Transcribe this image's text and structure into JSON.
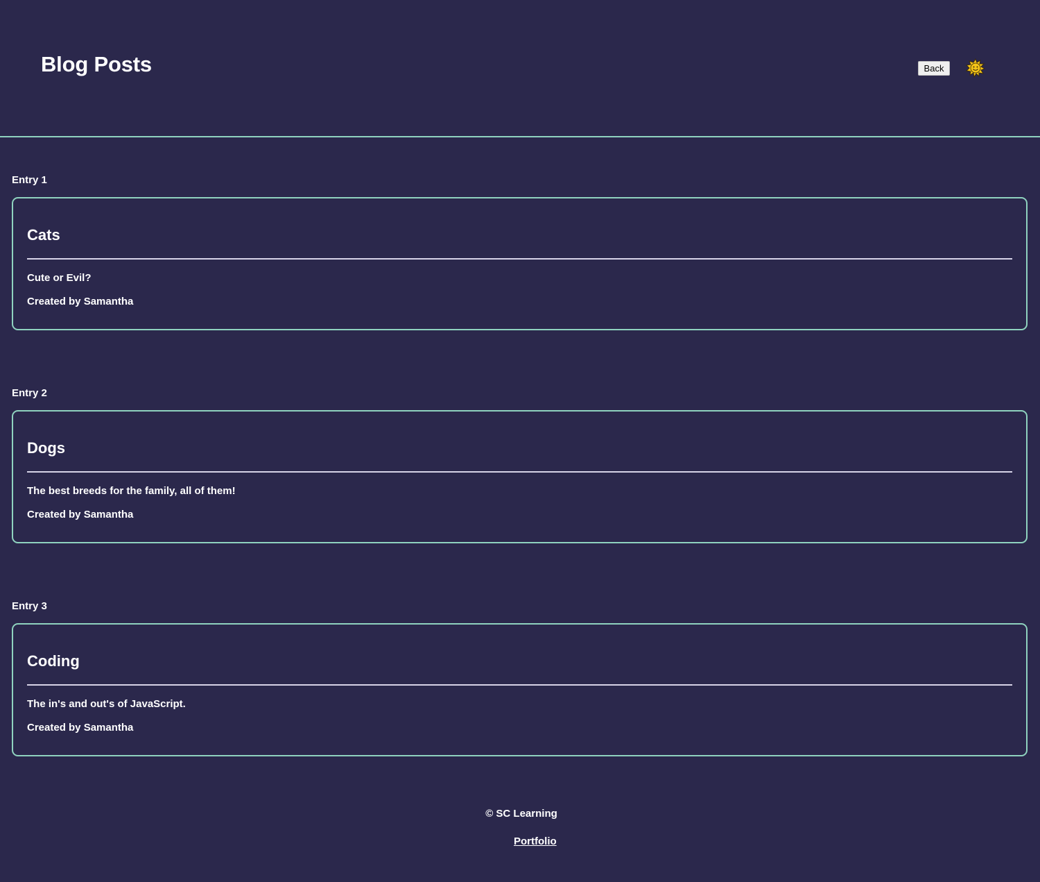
{
  "header": {
    "title": "Blog Posts",
    "back_label": "Back",
    "theme_icon": "sun-icon"
  },
  "entries": [
    {
      "label": "Entry 1",
      "title": "Cats",
      "description": "Cute or Evil?",
      "author": "Created by Samantha"
    },
    {
      "label": "Entry 2",
      "title": "Dogs",
      "description": "The best breeds for the family, all of them!",
      "author": "Created by Samantha"
    },
    {
      "label": "Entry 3",
      "title": "Coding",
      "description": "The in's and out's of JavaScript.",
      "author": "Created by Samantha"
    }
  ],
  "footer": {
    "copyright": "© SC Learning",
    "link_label": "Portfolio"
  },
  "colors": {
    "background": "#2b284c",
    "accent_border": "#8fd3bf",
    "text": "#ffffff",
    "sun": "#f5c518"
  }
}
